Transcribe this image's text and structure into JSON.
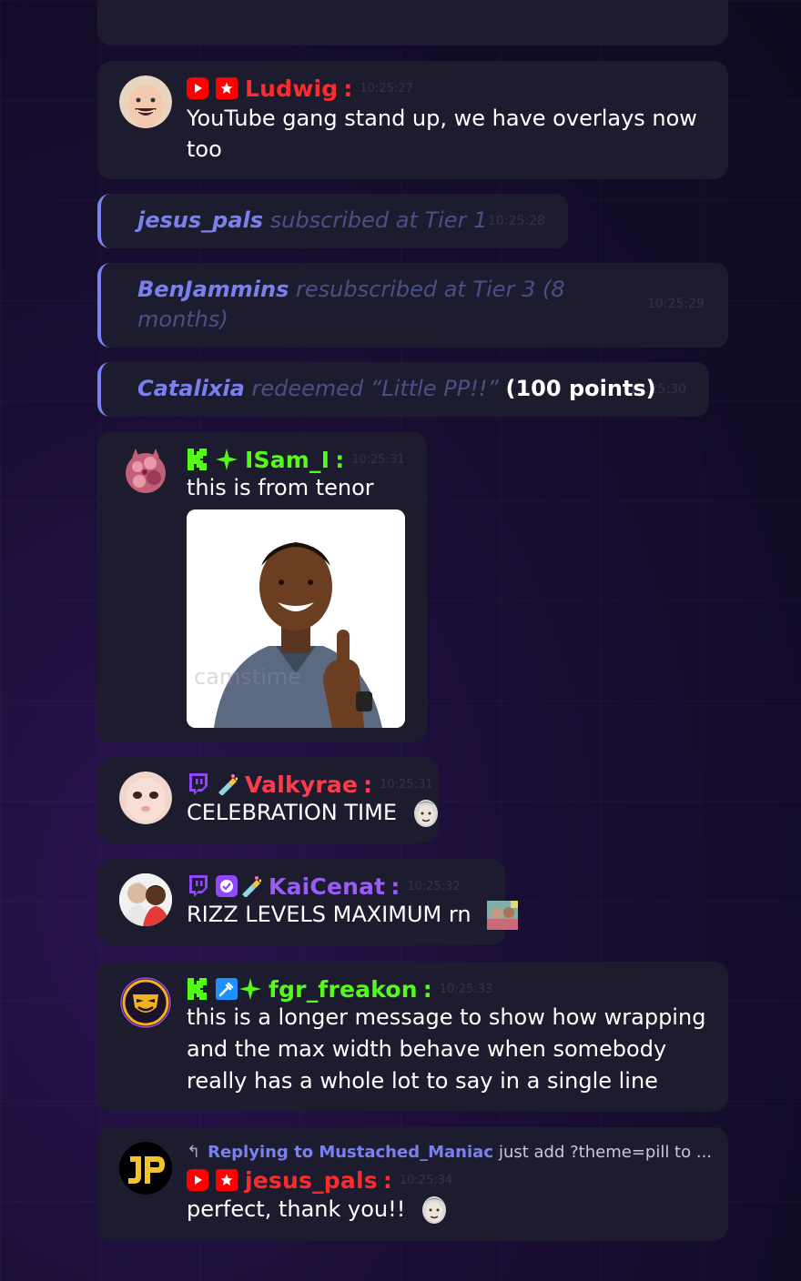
{
  "messages": {
    "ludwig": {
      "username": "Ludwig",
      "timestamp": "10:25:27",
      "text": "YouTube gang stand up, we have overlays now too",
      "platform": "youtube",
      "name_color": "#ff2b2b"
    },
    "isam": {
      "username": "ISam_I",
      "timestamp": "10:25:31",
      "text": "this is from tenor",
      "platform": "kick",
      "name_color": "#53fc18",
      "image_watermark": "camstime"
    },
    "valkyrae": {
      "username": "Valkyrae",
      "timestamp": "10:25:31",
      "text": "CELEBRATION TIME",
      "platform": "twitch",
      "name_color": "#ff3b4a"
    },
    "kaicenat": {
      "username": "KaiCenat",
      "timestamp": "10:25:32",
      "text": "RIZZ LEVELS MAXIMUM rn",
      "platform": "twitch",
      "name_color": "#9b5cf6"
    },
    "fgr": {
      "username": "fgr_freakon",
      "timestamp": "10:25:33",
      "text_line1": "this is a longer message to show how wrapping",
      "text_line2": "and the max width behave when somebody",
      "text_line3": "really has a whole lot to say in a single line",
      "platform": "kick",
      "name_color": "#53fc18"
    },
    "jesus_reply": {
      "reply_label": "Replying to Mustached_Maniac",
      "reply_preview": "just add ?theme=pill to ...",
      "username": "jesus_pals",
      "timestamp": "10:25:34",
      "text": "perfect, thank you!!",
      "platform": "youtube",
      "name_color": "#ff2b2b"
    }
  },
  "events": {
    "sub": {
      "username": "jesus_pals",
      "text": "subscribed at Tier 1",
      "timestamp": "10:25:28"
    },
    "resub": {
      "username": "BenJammins",
      "text_line1": "resubscribed at Tier 3 (8",
      "text_line2": "months)",
      "timestamp": "10:25:29"
    },
    "redeem": {
      "username": "Catalixia",
      "text": "redeemed “Little PP!!”",
      "points": "(100 points)",
      "timestamp": "10:25:30"
    }
  },
  "colors": {
    "card_bg": "#1d1c2f",
    "event_accent": "#7b83f0",
    "kick_green": "#53fc18",
    "youtube_red": "#ff2b2b",
    "twitch_purple": "#9146ff"
  }
}
